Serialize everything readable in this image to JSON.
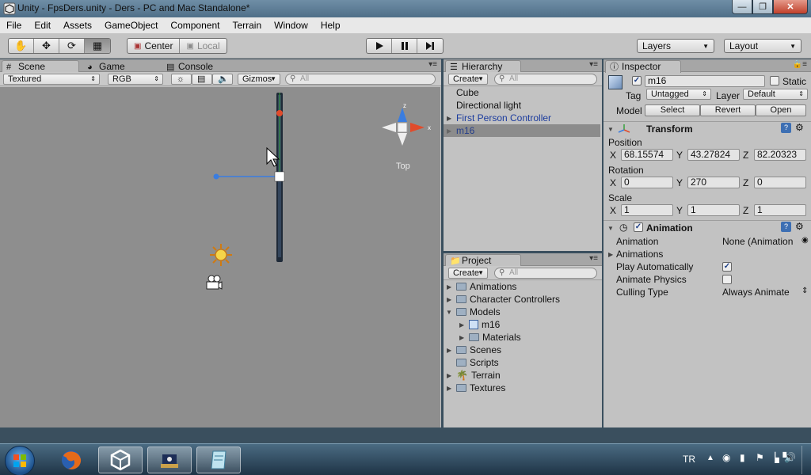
{
  "window": {
    "title": "Unity - FpsDers.unity - Ders - PC and Mac Standalone*"
  },
  "menu": [
    "File",
    "Edit",
    "Assets",
    "GameObject",
    "Component",
    "Terrain",
    "Window",
    "Help"
  ],
  "toolbar": {
    "pivot_center": "Center",
    "pivot_local": "Local",
    "layers_label": "Layers",
    "layout_label": "Layout"
  },
  "scene_panel": {
    "tabs": [
      "Scene",
      "Game",
      "Console"
    ],
    "render_mode": "Textured",
    "color_mode": "RGB",
    "gizmos_label": "Gizmos",
    "search_placeholder": "All",
    "gizmo_label": "Top",
    "axis_y": "y",
    "axis_z": "z",
    "axis_x": "x"
  },
  "hierarchy": {
    "tab": "Hierarchy",
    "create_label": "Create",
    "search_placeholder": "All",
    "items": [
      "Cube",
      "Directional light",
      "First Person Controller",
      "m16"
    ]
  },
  "project": {
    "tab": "Project",
    "create_label": "Create",
    "search_placeholder": "All",
    "items": [
      "Animations",
      "Character Controllers",
      "Models",
      "m16",
      "Materials",
      "Scenes",
      "Scripts",
      "Terrain",
      "Textures"
    ]
  },
  "inspector": {
    "tab": "Inspector",
    "object_name": "m16",
    "static_label": "Static",
    "tag_label": "Tag",
    "tag_value": "Untagged",
    "layer_label": "Layer",
    "layer_value": "Default",
    "model_label": "Model",
    "model_buttons": [
      "Select",
      "Revert",
      "Open"
    ],
    "transform": {
      "title": "Transform",
      "position_label": "Position",
      "position": {
        "x": "68.15574",
        "y": "43.27824",
        "z": "82.20323"
      },
      "rotation_label": "Rotation",
      "rotation": {
        "x": "0",
        "y": "270",
        "z": "0"
      },
      "scale_label": "Scale",
      "scale": {
        "x": "1",
        "y": "1",
        "z": "1"
      },
      "axis_x": "X",
      "axis_y": "Y",
      "axis_z": "Z"
    },
    "animation": {
      "title": "Animation",
      "animation_label": "Animation",
      "animation_value": "None (Animation",
      "animations_label": "Animations",
      "play_auto_label": "Play Automatically",
      "play_auto_checked": true,
      "animate_physics_label": "Animate Physics",
      "animate_physics_checked": false,
      "culling_label": "Culling Type",
      "culling_value": "Always Animate"
    }
  },
  "taskbar": {
    "language": "TR"
  }
}
